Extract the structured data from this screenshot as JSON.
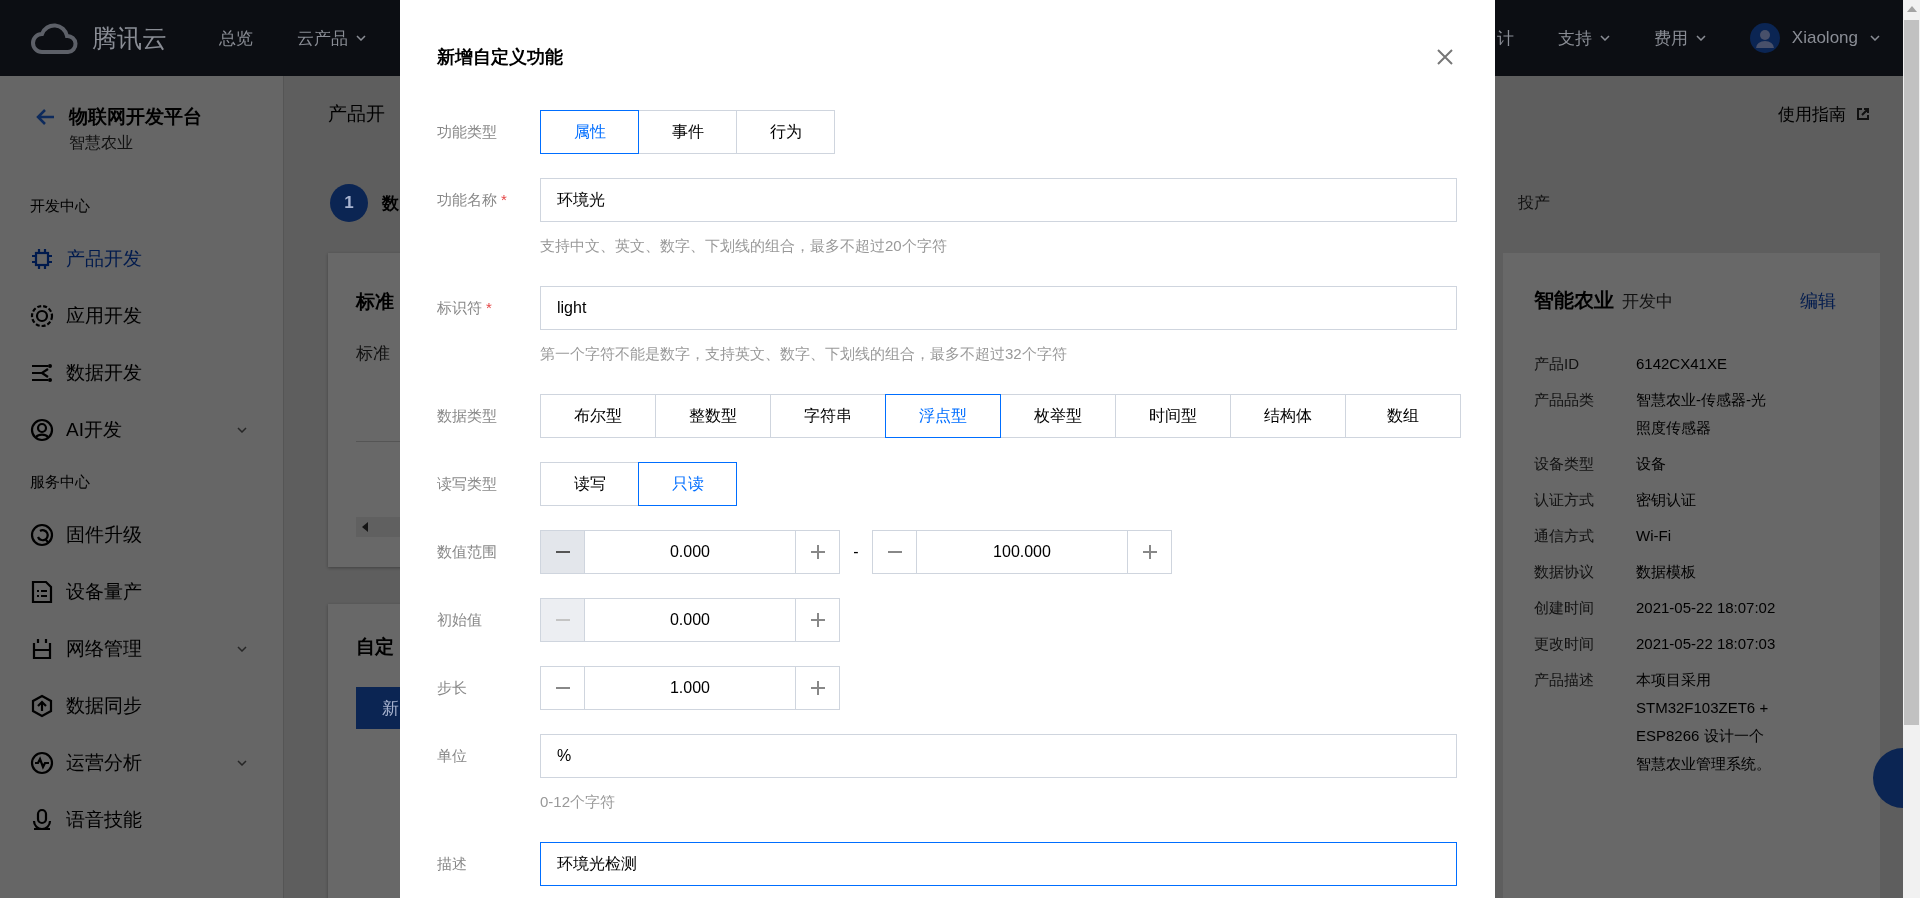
{
  "top_bar": {
    "logo_text": "腾讯云",
    "nav_left": [
      {
        "label": "总览",
        "has_dropdown": false
      },
      {
        "label": "云产品",
        "has_dropdown": true
      }
    ],
    "nav_right": [
      {
        "label": "计",
        "has_dropdown": false
      },
      {
        "label": "支持",
        "has_dropdown": true
      },
      {
        "label": "费用",
        "has_dropdown": true
      }
    ],
    "user": {
      "name": "Xiaolong",
      "has_dropdown": true
    }
  },
  "sidebar": {
    "title": "物联网开发平台",
    "subtitle": "智慧农业",
    "sections": [
      {
        "heading": "开发中心",
        "items": [
          {
            "label": "产品开发",
            "selected": true,
            "expandable": false
          },
          {
            "label": "应用开发",
            "selected": false,
            "expandable": false
          },
          {
            "label": "数据开发",
            "selected": false,
            "expandable": false
          },
          {
            "label": "AI开发",
            "selected": false,
            "expandable": true
          }
        ]
      },
      {
        "heading": "服务中心",
        "items": [
          {
            "label": "固件升级",
            "selected": false,
            "expandable": false
          },
          {
            "label": "设备量产",
            "selected": false,
            "expandable": false
          },
          {
            "label": "网络管理",
            "selected": false,
            "expandable": true
          },
          {
            "label": "数据同步",
            "selected": false,
            "expandable": false
          },
          {
            "label": "运营分析",
            "selected": false,
            "expandable": true
          },
          {
            "label": "语音技能",
            "selected": false,
            "expandable": false
          }
        ]
      }
    ]
  },
  "page": {
    "breadcrumb": "产品开",
    "guide_link": "使用指南",
    "step": {
      "number": "1",
      "label": "数"
    },
    "step_right": "投产",
    "cards": [
      {
        "title": "标准",
        "text": "标准"
      },
      {
        "title": "自定",
        "button": "新"
      }
    ],
    "product_card": {
      "title": "智能农业",
      "status": "开发中",
      "edit_link": "编辑",
      "rows": [
        {
          "label": "产品ID",
          "value": "6142CX41XE"
        },
        {
          "label": "产品品类",
          "value": "智慧农业-传感器-光照度传感器"
        },
        {
          "label": "设备类型",
          "value": "设备"
        },
        {
          "label": "认证方式",
          "value": "密钥认证"
        },
        {
          "label": "通信方式",
          "value": "Wi-Fi"
        },
        {
          "label": "数据协议",
          "value": "数据模板"
        },
        {
          "label": "创建时间",
          "value": "2021-05-22 18:07:02"
        },
        {
          "label": "更改时间",
          "value": "2021-05-22 18:07:03"
        },
        {
          "label": "产品描述",
          "value": "本项目采用STM32F103ZET6 + ESP8266 设计一个智慧农业管理系统。"
        }
      ]
    }
  },
  "dialog": {
    "title": "新增自定义功能",
    "fields": [
      {
        "kind": "segmented",
        "label": "功能类型",
        "options": [
          {
            "label": "属性",
            "selected": true
          },
          {
            "label": "事件",
            "selected": false
          },
          {
            "label": "行为",
            "selected": false
          }
        ]
      },
      {
        "kind": "text",
        "label": "功能名称",
        "required_mark": "*",
        "value": "环境光",
        "focused": false,
        "hint": "支持中文、英文、数字、下划线的组合，最多不超过20个字符"
      },
      {
        "kind": "text",
        "label": "标识符",
        "required_mark": "*",
        "value": "light",
        "focused": false,
        "hint": "第一个字符不能是数字，支持英文、数字、下划线的组合，最多不超过32个字符"
      },
      {
        "kind": "segmented",
        "label": "数据类型",
        "options": [
          {
            "label": "布尔型",
            "selected": false
          },
          {
            "label": "整数型",
            "selected": false
          },
          {
            "label": "字符串",
            "selected": false
          },
          {
            "label": "浮点型",
            "selected": true
          },
          {
            "label": "枚举型",
            "selected": false
          },
          {
            "label": "时间型",
            "selected": false
          },
          {
            "label": "结构体",
            "selected": false
          },
          {
            "label": "数组",
            "selected": false
          }
        ]
      },
      {
        "kind": "segmented",
        "label": "读写类型",
        "options": [
          {
            "label": "读写",
            "selected": false
          },
          {
            "label": "只读",
            "selected": true
          }
        ]
      },
      {
        "kind": "stepper",
        "label": "数值范围",
        "separator": "-",
        "steppers": [
          {
            "value": "0.000",
            "minus_pressed": true,
            "minus_disabled": false
          },
          {
            "value": "100.000",
            "minus_pressed": false,
            "minus_disabled": false
          }
        ]
      },
      {
        "kind": "stepper",
        "label": "初始值",
        "steppers": [
          {
            "value": "0.000",
            "minus_pressed": false,
            "minus_disabled": true
          }
        ]
      },
      {
        "kind": "stepper",
        "label": "步长",
        "steppers": [
          {
            "value": "1.000",
            "minus_pressed": false,
            "minus_disabled": false
          }
        ]
      },
      {
        "kind": "text",
        "label": "单位",
        "value": "%",
        "focused": false,
        "hint": "0-12个字符"
      },
      {
        "kind": "text",
        "label": "描述",
        "value": "环境光检测",
        "focused": true
      }
    ]
  }
}
